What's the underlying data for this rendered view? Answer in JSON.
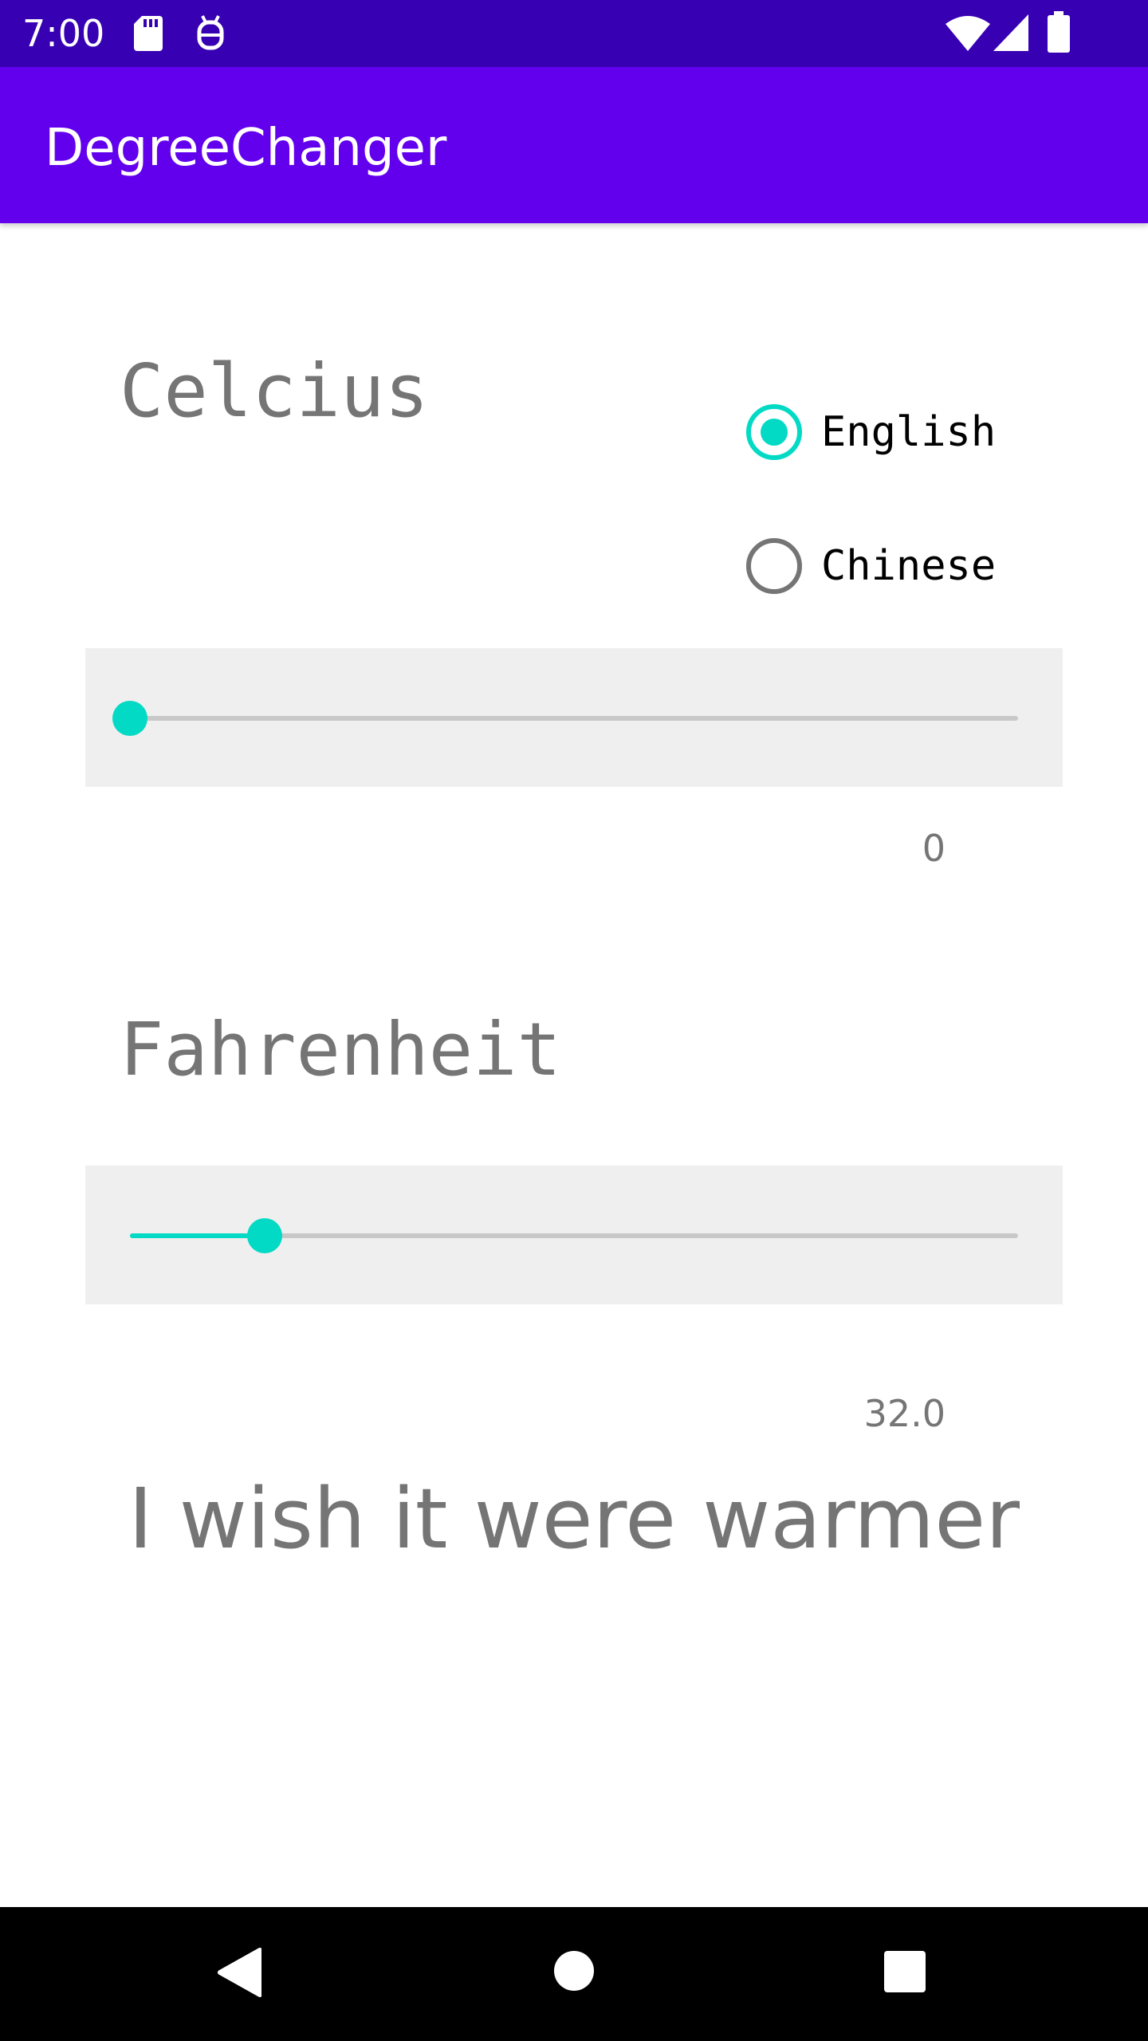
{
  "status_bar": {
    "time": "7:00",
    "icons": [
      "sd-card-icon",
      "debug-icon",
      "wifi-icon",
      "signal-icon",
      "battery-icon"
    ]
  },
  "app_bar": {
    "title": "DegreeChanger"
  },
  "celsius": {
    "label": "Celcius",
    "value": "0",
    "slider_fraction": 0.0
  },
  "language": {
    "options": [
      {
        "label": "English",
        "checked": true
      },
      {
        "label": "Chinese",
        "checked": false
      }
    ]
  },
  "fahrenheit": {
    "label": "Fahrenheit",
    "value": "32.0",
    "slider_fraction": 0.152
  },
  "message": "I wish it were warmer",
  "nav_bar": {
    "buttons": [
      "back-icon",
      "home-icon",
      "recents-icon"
    ]
  },
  "colors": {
    "status_bar": "#3700b3",
    "app_bar": "#6200ee",
    "accent": "#03dac5",
    "muted_text": "#757575"
  }
}
